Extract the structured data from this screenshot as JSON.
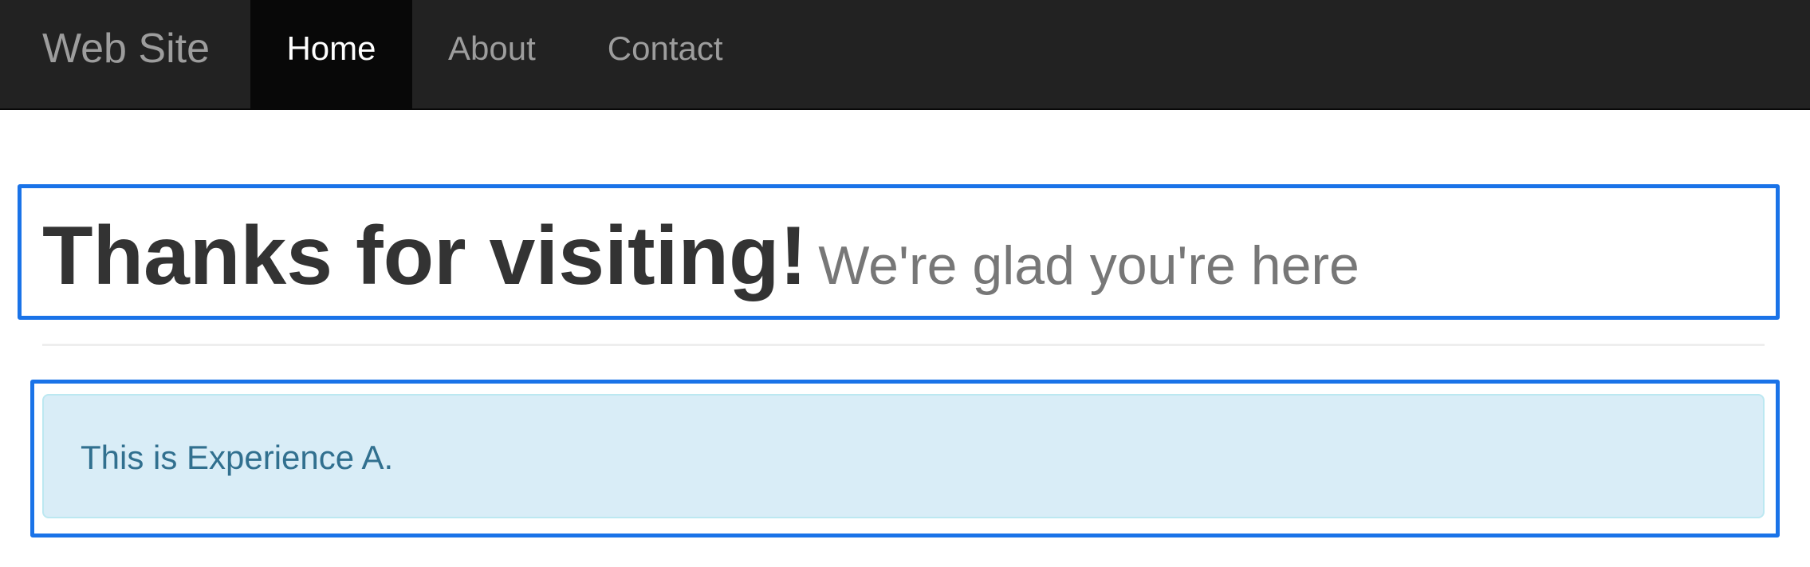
{
  "navbar": {
    "brand": "Web Site",
    "items": [
      {
        "label": "Home",
        "active": true
      },
      {
        "label": "About",
        "active": false
      },
      {
        "label": "Contact",
        "active": false
      }
    ]
  },
  "header": {
    "title": "Thanks for visiting!",
    "subtitle": "We're glad you're here"
  },
  "alert": {
    "text": "This is Experience A."
  },
  "colors": {
    "navbar_bg": "#222222",
    "navbar_active_bg": "#080808",
    "outline": "#1a73e8",
    "alert_bg": "#d9edf7",
    "alert_text": "#31708f"
  }
}
